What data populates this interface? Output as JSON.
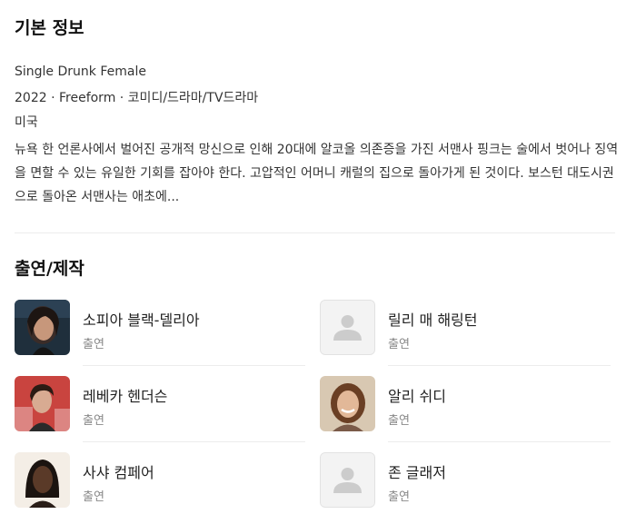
{
  "basic_info": {
    "title": "기본 정보",
    "original_title": "Single Drunk Female",
    "meta": "2022 · Freeform · 코미디/드라마/TV드라마",
    "country": "미국",
    "synopsis": "뉴욕 한 언론사에서 벌어진 공개적 망신으로 인해 20대에 알코올 의존증을 가진 서맨사 핑크는 술에서 벗어나 징역을 면할 수 있는 유일한 기회를 잡아야 한다. 고압적인 어머니 캐럴의 집으로 돌아가게 된 것이다. 보스턴 대도시권으로 돌아온 서맨사는 애초에..."
  },
  "cast": {
    "title": "출연/제작",
    "people": [
      {
        "name": "소피아 블랙-델리아",
        "role": "출연",
        "photo": "photo"
      },
      {
        "name": "릴리 매 해링턴",
        "role": "출연",
        "photo": "placeholder"
      },
      {
        "name": "레베카 헨더슨",
        "role": "출연",
        "photo": "photo"
      },
      {
        "name": "알리 쉬디",
        "role": "출연",
        "photo": "photo"
      },
      {
        "name": "사샤 컴페어",
        "role": "출연",
        "photo": "photo"
      },
      {
        "name": "존 글래저",
        "role": "출연",
        "photo": "placeholder"
      }
    ]
  },
  "colors": {
    "text": "#222222",
    "muted": "#888888",
    "divider": "#ececec",
    "placeholder_bg": "#f3f3f3",
    "placeholder_icon": "#cccccc"
  }
}
